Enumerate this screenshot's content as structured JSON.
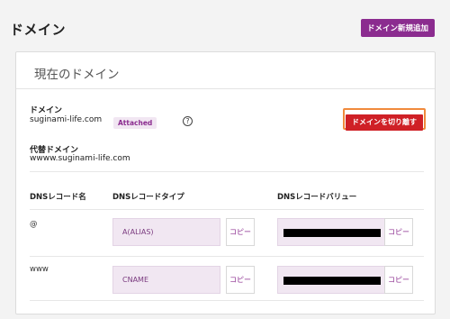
{
  "page": {
    "title": "ドメイン",
    "add_button": "ドメイン新規追加"
  },
  "card": {
    "title": "現在のドメイン",
    "domain_label": "ドメイン",
    "domain_value": "suginami-life.com",
    "status_badge": "Attached",
    "help_icon": "?",
    "detach_button": "ドメインを切り離す",
    "alt_label": "代替ドメイン",
    "alt_value": "wwww.suginami-life.com"
  },
  "dns": {
    "headers": {
      "name": "DNSレコード名",
      "type": "DNSレコードタイプ",
      "value": "DNSレコードバリュー"
    },
    "copy_label": "コピー",
    "records": [
      {
        "name": "@",
        "type": "A(ALIAS)"
      },
      {
        "name": "www",
        "type": "CNAME"
      }
    ]
  },
  "colors": {
    "brand": "#8b2c8f",
    "danger": "#cf2026",
    "highlight": "#f08a3c"
  }
}
